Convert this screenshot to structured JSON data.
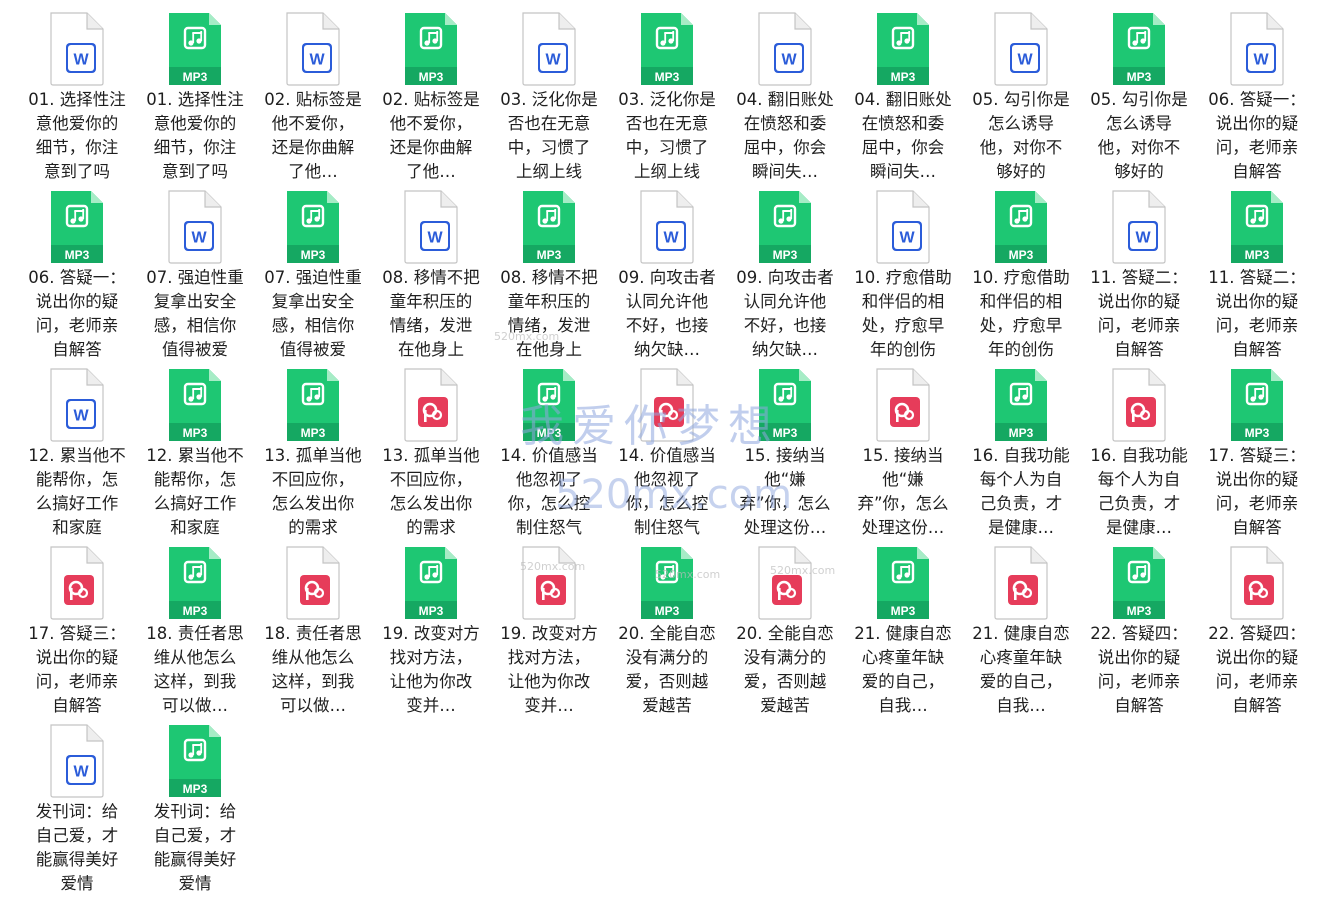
{
  "watermark": {
    "text": "我爱你梦想",
    "url": "520mx.com",
    "small": "520mx.com"
  },
  "colors": {
    "word": "#2b5cd9",
    "mp3": "#1ec773",
    "pdf": "#e63c5a"
  },
  "files": [
    {
      "type": "word",
      "name": "01. 选择性注意他爱你的细节，你注意到了吗"
    },
    {
      "type": "mp3",
      "name": "01. 选择性注意他爱你的细节，你注意到了吗"
    },
    {
      "type": "word",
      "name": "02. 贴标签是他不爱你，还是你曲解了他…"
    },
    {
      "type": "mp3",
      "name": "02. 贴标签是他不爱你，还是你曲解了他…"
    },
    {
      "type": "word",
      "name": "03. 泛化你是否也在无意中，习惯了上纲上线"
    },
    {
      "type": "mp3",
      "name": "03. 泛化你是否也在无意中，习惯了上纲上线"
    },
    {
      "type": "word",
      "name": "04. 翻旧账处在愤怒和委屈中，你会瞬间失…"
    },
    {
      "type": "mp3",
      "name": "04. 翻旧账处在愤怒和委屈中，你会瞬间失…"
    },
    {
      "type": "word",
      "name": "05. 勾引你是怎么诱导他，对你不够好的"
    },
    {
      "type": "mp3",
      "name": "05. 勾引你是怎么诱导他，对你不够好的"
    },
    {
      "type": "word",
      "name": "06. 答疑一：说出你的疑问，老师亲自解答"
    },
    {
      "type": "mp3",
      "name": "06. 答疑一：说出你的疑问，老师亲自解答"
    },
    {
      "type": "word",
      "name": "07. 强迫性重复拿出安全感，相信你值得被爱"
    },
    {
      "type": "mp3",
      "name": "07. 强迫性重复拿出安全感，相信你值得被爱"
    },
    {
      "type": "word",
      "name": "08. 移情不把童年积压的情绪，发泄在他身上"
    },
    {
      "type": "mp3",
      "name": "08. 移情不把童年积压的情绪，发泄在他身上"
    },
    {
      "type": "word",
      "name": "09. 向攻击者认同允许他不好，也接纳欠缺…"
    },
    {
      "type": "mp3",
      "name": "09. 向攻击者认同允许他不好，也接纳欠缺…"
    },
    {
      "type": "word",
      "name": "10. 疗愈借助和伴侣的相处，疗愈早年的创伤"
    },
    {
      "type": "mp3",
      "name": "10. 疗愈借助和伴侣的相处，疗愈早年的创伤"
    },
    {
      "type": "word",
      "name": "11. 答疑二：说出你的疑问，老师亲自解答"
    },
    {
      "type": "mp3",
      "name": "11. 答疑二：说出你的疑问，老师亲自解答"
    },
    {
      "type": "word",
      "name": "12. 累当他不能帮你，怎么搞好工作和家庭"
    },
    {
      "type": "mp3",
      "name": "12. 累当他不能帮你，怎么搞好工作和家庭"
    },
    {
      "type": "mp3",
      "name": "13. 孤单当他不回应你，怎么发出你的需求"
    },
    {
      "type": "pdf",
      "name": "13. 孤单当他不回应你，怎么发出你的需求"
    },
    {
      "type": "mp3",
      "name": "14. 价值感当他忽视了你，怎么控制住怒气"
    },
    {
      "type": "pdf",
      "name": "14. 价值感当他忽视了你，怎么控制住怒气"
    },
    {
      "type": "mp3",
      "name": "15. 接纳当他“嫌弃”你，怎么处理这份恐惧"
    },
    {
      "type": "pdf",
      "name": "15. 接纳当他“嫌弃”你，怎么处理这份恐惧"
    },
    {
      "type": "mp3",
      "name": "16. 自我功能每个人为自己负责，才是健康…"
    },
    {
      "type": "pdf",
      "name": "16. 自我功能每个人为自己负责，才是健康…"
    },
    {
      "type": "mp3",
      "name": "17. 答疑三：说出你的疑问，老师亲自解答"
    },
    {
      "type": "pdf",
      "name": "17. 答疑三：说出你的疑问，老师亲自解答"
    },
    {
      "type": "mp3",
      "name": "18. 责任者思维从他怎么这样，到我可以做…"
    },
    {
      "type": "pdf",
      "name": "18. 责任者思维从他怎么这样，到我可以做…"
    },
    {
      "type": "mp3",
      "name": "19. 改变对方找对方法，让他为你改变并…"
    },
    {
      "type": "pdf",
      "name": "19. 改变对方找对方法，让他为你改变并…"
    },
    {
      "type": "mp3",
      "name": "20. 全能自恋没有满分的爱，否则越爱越苦"
    },
    {
      "type": "pdf",
      "name": "20. 全能自恋没有满分的爱，否则越爱越苦"
    },
    {
      "type": "mp3",
      "name": "21. 健康自恋心疼童年缺爱的自己，自我…"
    },
    {
      "type": "pdf",
      "name": "21. 健康自恋心疼童年缺爱的自己，自我…"
    },
    {
      "type": "mp3",
      "name": "22. 答疑四：说出你的疑问，老师亲自解答"
    },
    {
      "type": "pdf",
      "name": "22. 答疑四：说出你的疑问，老师亲自解答"
    },
    {
      "type": "word",
      "name": "发刊词：给自己爱，才能赢得美好爱情"
    },
    {
      "type": "mp3",
      "name": "发刊词：给自己爱，才能赢得美好爱情"
    }
  ]
}
